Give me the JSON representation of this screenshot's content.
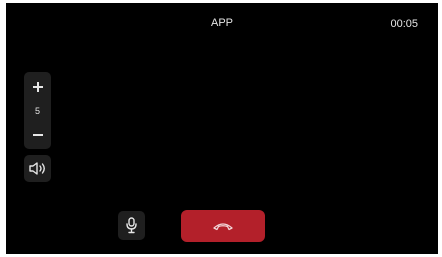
{
  "app": {
    "title": "APP",
    "timer": "00:05"
  },
  "volume": {
    "level": "5",
    "increase_icon": "plus-icon",
    "decrease_icon": "minus-icon"
  },
  "controls": {
    "speaker_icon": "speaker-icon",
    "mic_icon": "microphone-icon",
    "hangup_icon": "phone-hangup-icon"
  },
  "colors": {
    "background": "#000000",
    "panel": "#1f1f1f",
    "hangup": "#b3202a",
    "text": "#e6e6e6"
  }
}
